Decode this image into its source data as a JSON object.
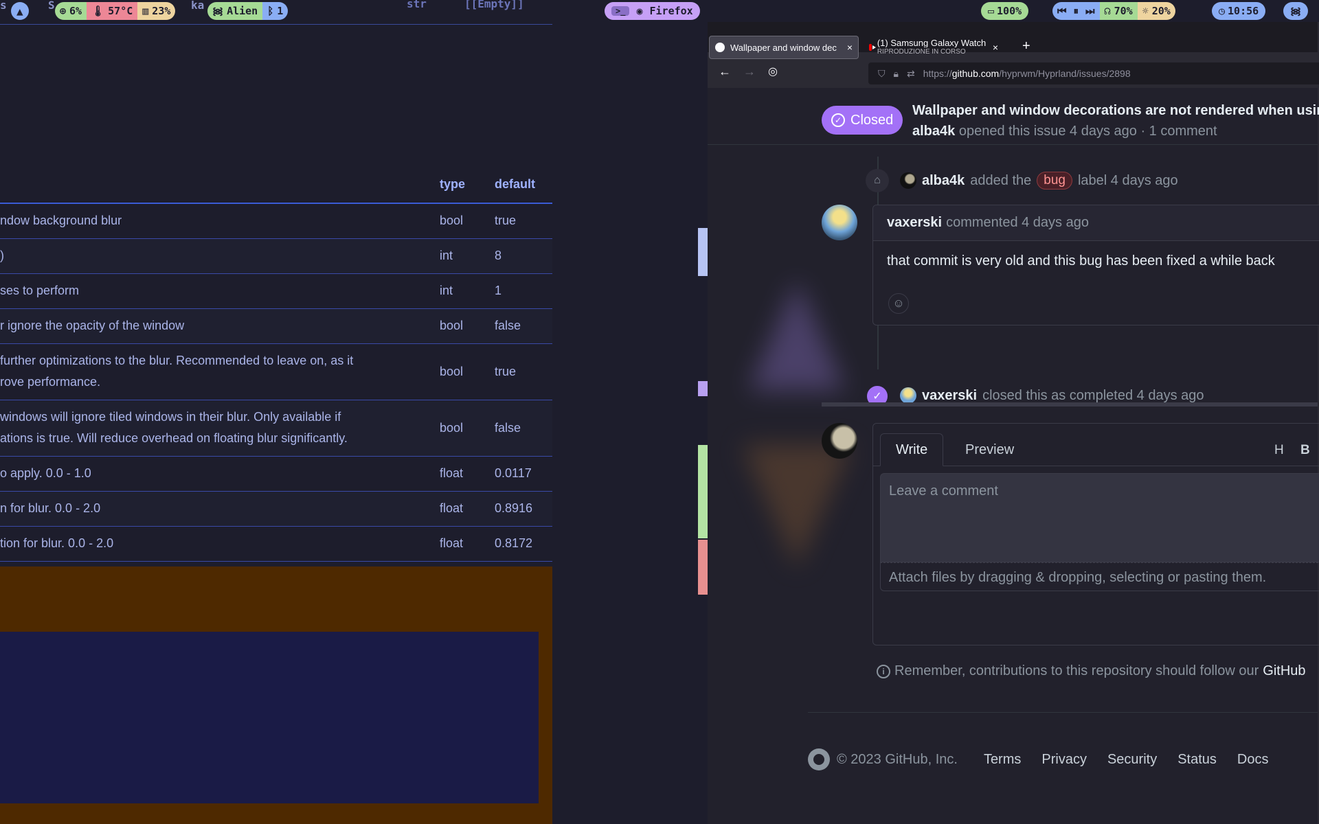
{
  "bar": {
    "cpu": "6%",
    "temp": "57°C",
    "memory": "23%",
    "wifi": "Alien",
    "bluetooth": "1",
    "window": "Firefox",
    "battery": "100%",
    "volume": "70%",
    "brightness": "20%",
    "clock": "10:56",
    "behind_left": "s",
    "behind_mid": "S",
    "behind_mid2": "ka",
    "behind_right1": "str",
    "behind_right2": "[[Empty]]"
  },
  "left_window": {
    "table": {
      "headers": {
        "type": "type",
        "default": "default"
      },
      "rows": [
        {
          "desc": "ndow background blur",
          "type": "bool",
          "default": "true"
        },
        {
          "desc": ")",
          "type": "int",
          "default": "8"
        },
        {
          "desc": "ses to perform",
          "type": "int",
          "default": "1"
        },
        {
          "desc": "r ignore the opacity of the window",
          "type": "bool",
          "default": "false"
        },
        {
          "desc": "further optimizations to the blur. Recommended to leave on, as it rove performance.",
          "desc_l1": "further optimizations to the blur. Recommended to leave on, as it",
          "desc_l2": "rove performance.",
          "type": "bool",
          "default": "true"
        },
        {
          "desc_l1": "windows will ignore tiled windows in their blur. Only available if",
          "desc_l2": "ations is true. Will reduce overhead on floating blur significantly.",
          "type": "bool",
          "default": "false"
        },
        {
          "desc": "o apply. 0.0 - 1.0",
          "type": "float",
          "default": "0.0117"
        },
        {
          "desc": "n for blur. 0.0 - 2.0",
          "type": "float",
          "default": "0.8916"
        },
        {
          "desc": "tion for blur. 0.0 - 2.0",
          "type": "float",
          "default": "0.8172"
        }
      ]
    }
  },
  "firefox": {
    "tabs": [
      {
        "title": "Wallpaper and window dec",
        "close": "×"
      },
      {
        "title": "(1) Samsung Galaxy Watch",
        "subtitle": "RIPRODUZIONE IN CORSO",
        "close": "×"
      }
    ],
    "new_tab": "+",
    "url_prefix": "https://",
    "url_host": "github.com",
    "url_path": "/hyprwm/Hyprland/issues/2898",
    "issue": {
      "state": "Closed",
      "title": "Wallpaper and window decorations are not rendered when using",
      "author": "alba4k",
      "meta_rest": "opened this issue 4 days ago · 1 comment"
    },
    "timeline": {
      "label_event": {
        "user": "alba4k",
        "pre": "added the",
        "label": "bug",
        "post": "label 4 days ago"
      },
      "comment": {
        "user": "vaxerski",
        "action": "commented 4 days ago",
        "body": "that commit is very old and this bug has been fixed a while back"
      },
      "close_event": {
        "user": "vaxerski",
        "action": "closed this as completed 4 days ago"
      }
    },
    "composer": {
      "tab_write": "Write",
      "tab_preview": "Preview",
      "fmt_h": "H",
      "fmt_b": "B",
      "placeholder": "Leave a comment",
      "attach": "Attach files by dragging & dropping, selecting or pasting them."
    },
    "remember": "Remember, contributions to this repository should follow our",
    "remember_link": "GitHub",
    "footer": {
      "copyright": "© 2023 GitHub, Inc.",
      "links": [
        "Terms",
        "Privacy",
        "Security",
        "Status",
        "Docs"
      ]
    }
  },
  "colors": {
    "bar_green": "#a6da95",
    "bar_red": "#ed8796",
    "bar_yellow": "#eed49f",
    "bar_blue": "#8aadf4",
    "bar_mauve": "#c6a0f6",
    "gh_purple": "#a371f7"
  }
}
